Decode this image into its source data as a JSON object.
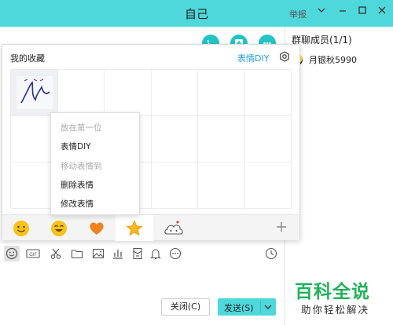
{
  "window": {
    "title": "自己",
    "report_label": "举报"
  },
  "members": {
    "header": "群聊成员(1/1)",
    "list": [
      {
        "name": "月银秋5990"
      }
    ]
  },
  "emoji_panel": {
    "title": "我的收藏",
    "diy_link": "表情DIY",
    "context_menu": [
      {
        "label": "放在第一位",
        "enabled": false
      },
      {
        "label": "表情DIY",
        "enabled": true
      },
      {
        "label": "移动表情到",
        "enabled": false
      },
      {
        "label": "删除表情",
        "enabled": true
      },
      {
        "label": "修改表情",
        "enabled": true
      }
    ],
    "tabs": [
      {
        "icon": "smiley-emoji-icon"
      },
      {
        "icon": "grin-emoji-icon"
      },
      {
        "icon": "heart-icon"
      },
      {
        "icon": "star-icon",
        "active": true
      },
      {
        "icon": "cloud-face-icon"
      }
    ]
  },
  "toolbar": {
    "icons": [
      "smiley-icon",
      "gif-icon",
      "scissors-icon",
      "folder-icon",
      "image-icon",
      "chart-icon",
      "red-packet-icon",
      "bell-icon",
      "more-icon",
      "clock-icon"
    ]
  },
  "buttons": {
    "close_label": "关闭(C)",
    "send_label": "发送(S)"
  },
  "watermark": {
    "title": "百科全说",
    "subtitle": "助你轻松解决"
  },
  "colors": {
    "accent": "#4fd8dc",
    "link": "#1e9fd8",
    "watermark": "#21b35a"
  }
}
